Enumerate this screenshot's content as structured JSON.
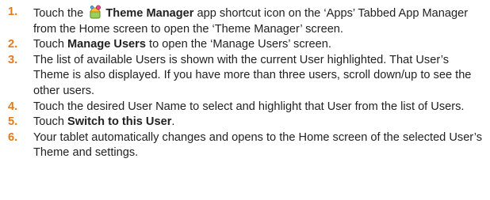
{
  "steps": [
    {
      "number": "1.",
      "text_before": "Touch the",
      "bold": "Theme Manager",
      "text_after": "app shortcut icon on the ‘Apps’ Tabbed App Manager from the Home screen to open the ‘Theme Manager’ screen.",
      "icon": "theme-manager-icon"
    },
    {
      "number": "2.",
      "text_before": "Touch",
      "bold": "Manage Users",
      "text_after": "to open the ‘Manage Users’ screen."
    },
    {
      "number": "3.",
      "text": "The list of available Users is shown with the current User highlighted. That User’s Theme is also displayed. If you have more than three users, scroll down/up to see the other users."
    },
    {
      "number": "4.",
      "text": "Touch the desired User Name to select and highlight that User from the list of Users."
    },
    {
      "number": "5.",
      "text_before": "Touch",
      "bold": "Switch to this User",
      "text_after": "."
    },
    {
      "number": "6.",
      "text": "Your tablet automatically changes and opens to the Home screen of the selected User’s Theme and settings."
    }
  ],
  "colors": {
    "number": "#e07b20",
    "text": "#222222"
  }
}
